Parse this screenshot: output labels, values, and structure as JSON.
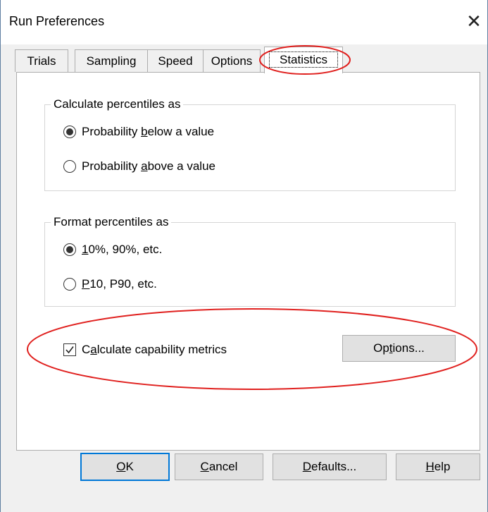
{
  "window": {
    "title": "Run Preferences",
    "close_glyph": "✕"
  },
  "tabs": [
    {
      "label": "Trials"
    },
    {
      "label": "Sampling"
    },
    {
      "label": "Speed"
    },
    {
      "label": "Options"
    },
    {
      "label": "Statistics",
      "selected": true
    }
  ],
  "percentiles_group": {
    "legend": "Calculate percentiles as",
    "options": [
      {
        "pre": "Probability ",
        "ul": "b",
        "post": "elow a value",
        "selected": true
      },
      {
        "pre": "Probability ",
        "ul": "a",
        "post": "bove a value",
        "selected": false
      }
    ]
  },
  "format_group": {
    "legend": "Format percentiles as",
    "options": [
      {
        "pre": "",
        "ul": "1",
        "post": "0%, 90%, etc.",
        "selected": true
      },
      {
        "pre": "",
        "ul": "P",
        "post": "10, P90, etc.",
        "selected": false
      }
    ]
  },
  "capability": {
    "checkbox_pre": "C",
    "checkbox_ul": "a",
    "checkbox_post": "lculate capability metrics",
    "checked": true,
    "options_pre": "Op",
    "options_ul": "t",
    "options_post": "ions..."
  },
  "buttons": {
    "ok_ul": "O",
    "ok_post": "K",
    "cancel_ul": "C",
    "cancel_post": "ancel",
    "defaults_ul": "D",
    "defaults_post": "efaults...",
    "help_ul": "H",
    "help_post": "elp"
  },
  "colors": {
    "annotation": "#e0201e",
    "focus_border": "#0078d7",
    "window_border": "#5e7ea0"
  },
  "icons": {
    "close": "close-icon",
    "checkmark": "checkmark-icon"
  }
}
